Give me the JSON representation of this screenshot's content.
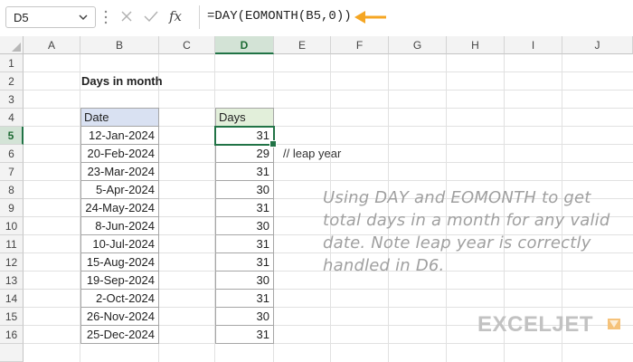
{
  "formula_bar": {
    "name_box": "D5",
    "formula": "=DAY(EOMONTH(B5,0))",
    "fx_label": "fx"
  },
  "columns": [
    "A",
    "B",
    "C",
    "D",
    "E",
    "F",
    "G",
    "H",
    "I",
    "J"
  ],
  "rows": [
    "1",
    "2",
    "3",
    "4",
    "5",
    "6",
    "7",
    "8",
    "9",
    "10",
    "11",
    "12",
    "13",
    "14",
    "15",
    "16"
  ],
  "sheet": {
    "title": "Days in month",
    "date_header": "Date",
    "days_header": "Days",
    "dates": [
      "12-Jan-2024",
      "20-Feb-2024",
      "23-Mar-2024",
      "5-Apr-2024",
      "24-May-2024",
      "8-Jun-2024",
      "10-Jul-2024",
      "15-Aug-2024",
      "19-Sep-2024",
      "2-Oct-2024",
      "26-Nov-2024",
      "25-Dec-2024"
    ],
    "days": [
      "31",
      "29",
      "31",
      "30",
      "31",
      "30",
      "31",
      "31",
      "30",
      "31",
      "30",
      "31"
    ],
    "comment": "//  leap year",
    "note": "Using DAY and EOMONTH to get total days in a month for any valid date. Note leap year is correctly handled in D6."
  },
  "logo": {
    "text": "EXCELJET"
  },
  "colors": {
    "arrow": "#f5a623",
    "selection": "#217346",
    "date_header_bg": "#d9e1f2",
    "days_header_bg": "#e2efda"
  },
  "selected": {
    "column": "D",
    "row": "5"
  }
}
